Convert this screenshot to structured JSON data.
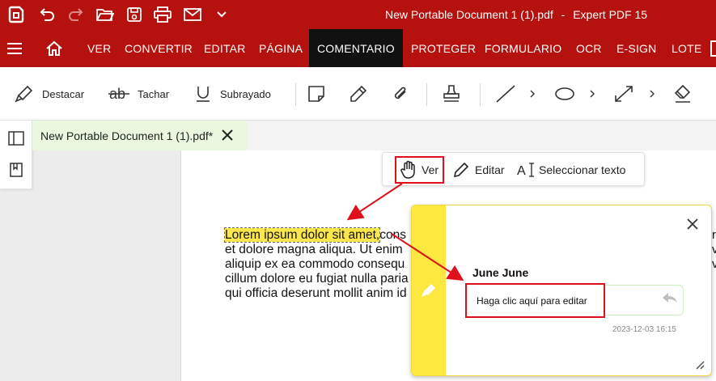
{
  "titlebar": {
    "doc_title": "New Portable Document 1 (1).pdf",
    "separator": "-",
    "app_name": "Expert PDF 15",
    "icons": [
      "logo-icon",
      "undo-icon",
      "redo-icon",
      "open-folder-icon",
      "save-icon",
      "print-icon",
      "email-icon",
      "chevron-down-icon"
    ]
  },
  "menu": {
    "items": [
      "VER",
      "CONVERTIR",
      "EDITAR",
      "PÁGINA",
      "COMENTARIO",
      "PROTEGER",
      "FORMULARIO",
      "OCR",
      "E-SIGN",
      "LOTE"
    ],
    "active": "COMENTARIO"
  },
  "toolbar": {
    "highlight": "Destacar",
    "strikethrough": "Tachar",
    "underline": "Subrayado"
  },
  "tab": {
    "name": "New Portable Document 1 (1).pdf*"
  },
  "floating_toolbar": {
    "view": "Ver",
    "edit": "Editar",
    "select_text": "Seleccionar texto"
  },
  "document": {
    "highlighted": "Lorem ipsum dolor sit amet,",
    "line1_rest": "cons",
    "line2": "et dolore magna aliqua. Ut enim",
    "line3": "aliquip ex ea commodo consequ",
    "line4": "cillum dolore eu fugiat nulla paria",
    "line5": "qui officia deserunt mollit anim id"
  },
  "comment": {
    "author": "June June",
    "placeholder": "Haga clic aquí para editar",
    "timestamp": "2023-12-03 16:15"
  },
  "colors": {
    "brand": "#b5120f",
    "active_menu": "#111111",
    "highlight": "#fde74c",
    "annotation_red": "#e0101a",
    "tab_bg": "#e9f8df"
  }
}
